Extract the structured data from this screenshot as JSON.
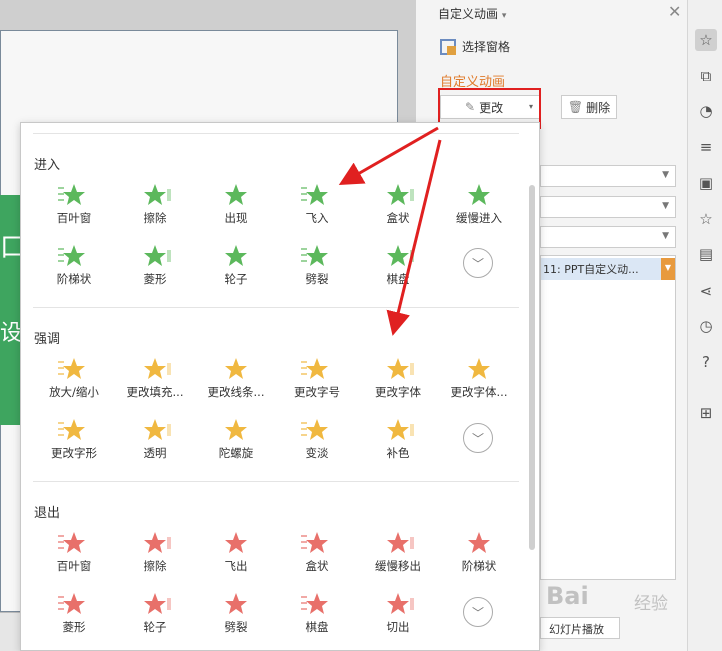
{
  "pane": {
    "title": "自定义动画",
    "title_caret": "▾",
    "close": "✕",
    "selection_pane": "选择窗格",
    "section_title": "自定义动画",
    "change_label": "更改",
    "delete_label": "删除",
    "animation_item": "11: PPT自定义动...",
    "play_label": "幻灯片播放"
  },
  "watermark": {
    "logo": "Bai",
    "sub": "经验"
  },
  "popup": {
    "entrance_title": "进入",
    "emphasis_title": "强调",
    "exit_title": "退出",
    "entrance": [
      {
        "label": "百叶窗",
        "icon": "blinds-star-icon"
      },
      {
        "label": "擦除",
        "icon": "wipe-star-icon"
      },
      {
        "label": "出现",
        "icon": "appear-star-icon"
      },
      {
        "label": "飞入",
        "icon": "fly-in-star-icon"
      },
      {
        "label": "盒状",
        "icon": "box-star-icon"
      },
      {
        "label": "缓慢进入",
        "icon": "crawl-in-star-icon"
      },
      {
        "label": "阶梯状",
        "icon": "stairs-star-icon"
      },
      {
        "label": "菱形",
        "icon": "diamond-star-icon"
      },
      {
        "label": "轮子",
        "icon": "wheel-star-icon"
      },
      {
        "label": "劈裂",
        "icon": "split-star-icon"
      },
      {
        "label": "棋盘",
        "icon": "checkerboard-star-icon"
      }
    ],
    "emphasis": [
      {
        "label": "放大/缩小",
        "icon": "grow-shrink-icon"
      },
      {
        "label": "更改填充...",
        "icon": "fill-color-icon"
      },
      {
        "label": "更改线条...",
        "icon": "line-color-icon"
      },
      {
        "label": "更改字号",
        "icon": "font-size-icon"
      },
      {
        "label": "更改字体",
        "icon": "font-icon"
      },
      {
        "label": "更改字体...",
        "icon": "font-color-icon"
      },
      {
        "label": "更改字形",
        "icon": "font-style-icon"
      },
      {
        "label": "透明",
        "icon": "transparency-icon"
      },
      {
        "label": "陀螺旋",
        "icon": "spin-icon"
      },
      {
        "label": "变淡",
        "icon": "fade-icon"
      },
      {
        "label": "补色",
        "icon": "complementary-color-icon"
      }
    ],
    "exit": [
      {
        "label": "百叶窗",
        "icon": "blinds-exit-icon"
      },
      {
        "label": "擦除",
        "icon": "wipe-exit-icon"
      },
      {
        "label": "飞出",
        "icon": "fly-out-icon"
      },
      {
        "label": "盒状",
        "icon": "box-exit-icon"
      },
      {
        "label": "缓慢移出",
        "icon": "crawl-out-icon"
      },
      {
        "label": "阶梯状",
        "icon": "stairs-exit-icon"
      },
      {
        "label": "菱形",
        "icon": "diamond-exit-icon"
      },
      {
        "label": "轮子",
        "icon": "wheel-exit-icon"
      },
      {
        "label": "劈裂",
        "icon": "split-exit-icon"
      },
      {
        "label": "棋盘",
        "icon": "checkerboard-exit-icon"
      },
      {
        "label": "切出",
        "icon": "cut-out-icon"
      }
    ]
  },
  "colors": {
    "entrance": "#5cb85c",
    "emphasis": "#f0b840",
    "exit": "#e8706a",
    "accent": "#e07a2a",
    "highlight": "#e02020"
  }
}
